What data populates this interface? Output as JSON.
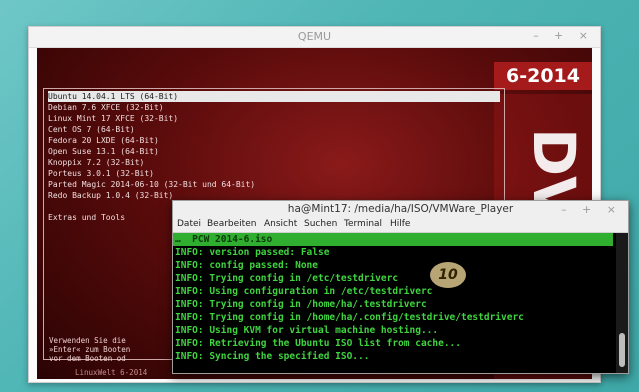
{
  "qemu": {
    "title": "QEMU",
    "controls": "– + ×"
  },
  "screen": {
    "badge": "6-2014",
    "dvd_text": "DVD",
    "menu_items": [
      "Ubuntu 14.04.1 LTS (64-Bit)",
      "Debian 7.6 XFCE (32-Bit)",
      "Linux Mint 17 XFCE (32-Bit)",
      "Cent OS 7 (64-Bit)",
      "Fedora 20 LXDE (64-Bit)",
      "Open Suse 13.1 (64-Bit)",
      "Knoppix 7.2 (32-Bit)",
      "Porteus 3.0.1 (32-Bit)",
      "Parted Magic 2014-06-10 (32-Bit und 64-Bit)",
      "Redo Backup 1.0.4 (32-Bit)",
      "",
      "Extras und Tools"
    ],
    "help_text": "Verwenden Sie die\n»Enter« zum Booten\nvor dem Booten od",
    "footer": "LinuxWelt 6-2014"
  },
  "terminal": {
    "title": "ha@Mint17: /media/ha/ISO/VMWare_Player",
    "controls": "– + ×",
    "menu": [
      "Datei",
      "Bearbeiten",
      "Ansicht",
      "Suchen",
      "Terminal",
      "Hilfe"
    ],
    "highlight_line": "…  PCW 2014-6.iso",
    "lines": [
      "INFO: version passed: False",
      "INFO: config passed: None",
      "INFO: Trying config in /etc/testdriverc",
      "INFO: Using configuration in /etc/testdriverc",
      "INFO: Trying config in /home/ha/.testdriverc",
      "INFO: Trying config in /home/ha/.config/testdrive/testdriverc",
      "INFO: Using KVM for virtual machine hosting...",
      "INFO: Retrieving the Ubuntu ISO list from cache...",
      "INFO: Syncing the specified ISO..."
    ],
    "badge": "10"
  }
}
